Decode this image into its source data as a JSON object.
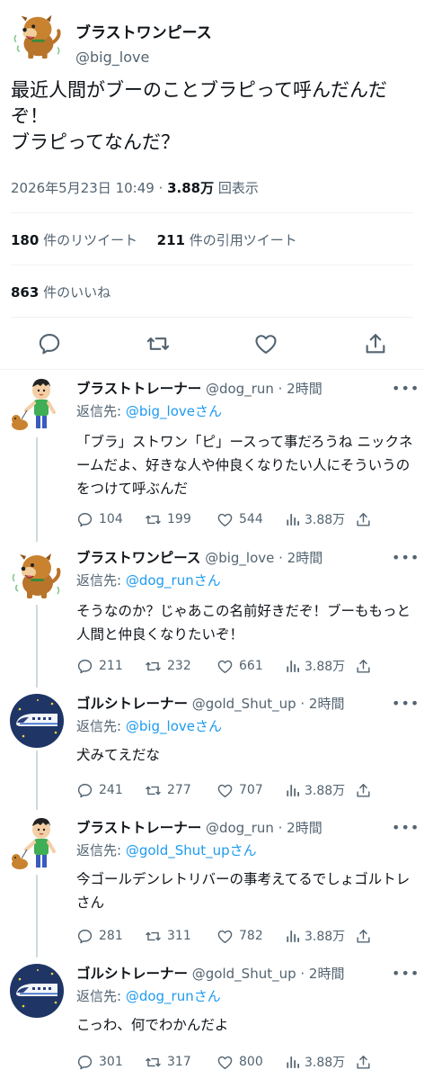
{
  "main": {
    "author_name": "ブラストワンピース",
    "author_handle": "@big_love",
    "text": "最近人間がブーのことブラピって呼んだんだぞ！\nブラピってなんだ？",
    "timestamp": "2026年5月23日 10:49 · ",
    "views": "3.88万",
    "views_label": " 回表示",
    "retweets_count": "180",
    "retweets_label": " 件のリツイート",
    "quotes_count": "211",
    "quotes_label": " 件の引用ツイート",
    "likes_count": "863",
    "likes_label": " 件のいいね"
  },
  "replies": [
    {
      "name": "ブラストトレーナー",
      "handle": " @dog_run · 2時間",
      "reply_prefix": "返信先: ",
      "reply_to": "@big_loveさん",
      "text": "「ブラ」ストワン「ピ」ースって事だろうね ニックネームだよ、好きな人や仲良くなりたい人にそういうのをつけて呼ぶんだ",
      "replies": "104",
      "retweets": "199",
      "likes": "544",
      "views": "3.88万"
    },
    {
      "name": "ブラストワンピース",
      "handle": " @big_love · 2時間",
      "reply_prefix": "返信先: ",
      "reply_to": "@dog_runさん",
      "text": "そうなのか？じゃあこの名前好きだぞ！ブーももっと人間と仲良くなりたいぞ！",
      "replies": "211",
      "retweets": "232",
      "likes": "661",
      "views": "3.88万"
    },
    {
      "name": "ゴルシトレーナー",
      "handle": " @gold_Shut_up · 2時間",
      "reply_prefix": "返信先: ",
      "reply_to": "@big_loveさん",
      "text": "犬みてえだな",
      "replies": "241",
      "retweets": "277",
      "likes": "707",
      "views": "3.88万"
    },
    {
      "name": "ブラストトレーナー",
      "handle": " @dog_run · 2時間",
      "reply_prefix": "返信先: ",
      "reply_to": "@gold_Shut_upさん",
      "text": "今ゴールデンレトリバーの事考えてるでしょゴルトレさん",
      "replies": "281",
      "retweets": "311",
      "likes": "782",
      "views": "3.88万"
    },
    {
      "name": "ゴルシトレーナー",
      "handle": " @gold_Shut_up · 2時間",
      "reply_prefix": "返信先: ",
      "reply_to": "@dog_runさん",
      "text": "こっわ、何でわかんだよ",
      "replies": "301",
      "retweets": "317",
      "likes": "800",
      "views": "3.88万"
    }
  ],
  "more_label": "•••",
  "colors": {
    "accent": "#1d9bf0",
    "muted": "#536471",
    "text": "#0f1419",
    "divider": "#eff3f4"
  },
  "icons": [
    "dog-avatar",
    "trainer-avatar",
    "train-avatar",
    "reply-icon",
    "retweet-icon",
    "like-icon",
    "views-icon",
    "share-icon"
  ]
}
